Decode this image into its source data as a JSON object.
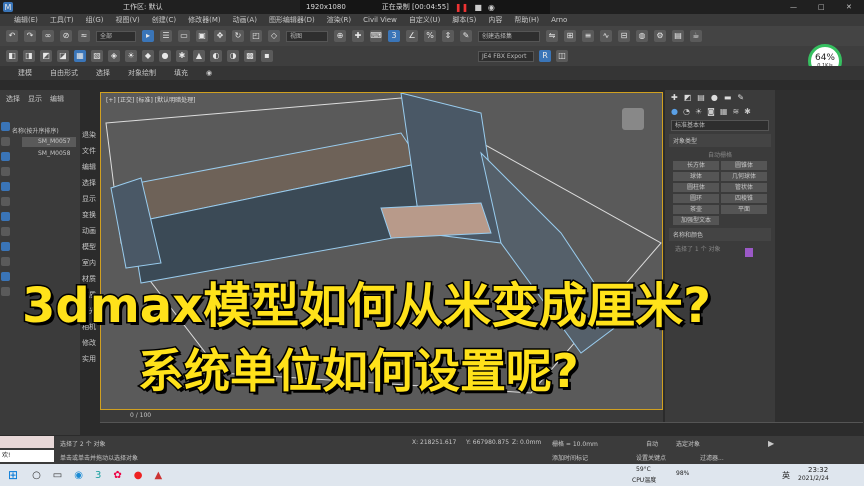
{
  "titlebar": {
    "workspace": "工作区: 默认",
    "resolution": "1920x1080",
    "recording": "正在录制 [00:04:55]"
  },
  "menubar": {
    "items": [
      "编辑(E)",
      "工具(T)",
      "组(G)",
      "视图(V)",
      "创建(C)",
      "修改器(M)",
      "动画(A)",
      "图形编辑器(D)",
      "渲染(R)",
      "Civil View",
      "自定义(U)",
      "脚本(S)",
      "内容",
      "帮助(H)",
      "Arno"
    ]
  },
  "toolbar": {
    "filter": "全部",
    "view": "视图",
    "named_set": "创建选择集"
  },
  "toolbar2": {
    "exporter": "JE4 FBX Export"
  },
  "ribbon": {
    "tabs": [
      "建模",
      "自由形式",
      "选择",
      "对象绘制",
      "填充"
    ]
  },
  "gauge": {
    "percent": "64%",
    "speed": "0.1K/s"
  },
  "scene_explorer": {
    "tabs": [
      "选择",
      "显示",
      "编辑"
    ],
    "sort_label": "名称(按升序排序)",
    "rows": [
      "SM_M0057",
      "SM_M0058"
    ]
  },
  "command_list": [
    "退染",
    "文件",
    "编辑",
    "选择",
    "显示",
    "变换",
    "动画",
    "模型",
    "室内",
    "材质",
    "材质",
    "灯光",
    "相机",
    "修改",
    "实用"
  ],
  "viewport": {
    "label": "[+] [正交] [标准] [默认明暗处理]"
  },
  "create_panel": {
    "dropdown": "标准基本体",
    "rollout": "对象类型",
    "autogrid": "自动栅格",
    "buttons": [
      "长方体",
      "圆锥体",
      "球体",
      "几何球体",
      "圆柱体",
      "管状体",
      "圆环",
      "四棱锥",
      "茶壶",
      "平面",
      "加强型文本"
    ],
    "name_color": "名称和颜色",
    "selection_info": "选择了 1 个 对象"
  },
  "timeline": {
    "frame": "0 / 100"
  },
  "status": {
    "selected": "选择了 2 个 对象",
    "prompt": "单击或单击并拖动以选择对象",
    "grid": "栅格 = 10.0mm",
    "autokey": "自动",
    "setkey": "设置关键点",
    "filter": "过滤器...",
    "select_obj": "选定对象",
    "add_time_tag": "添加时间标记",
    "x": "X: 218251.617",
    "y": "Y: 667980.875",
    "z": "Z: 0.0mm",
    "cmd": "欢!"
  },
  "taskbar": {
    "temp": "59°C",
    "temp_label": "CPU温度",
    "battery": "98%",
    "lang": "英",
    "time": "23:32",
    "date": "2021/2/24"
  },
  "overlay": {
    "line1": "3dmax模型如何从米变成厘米?",
    "line2": "系统单位如何设置呢?"
  },
  "colors": {
    "accent": "#3a75b8",
    "viewport_border": "#d0a020",
    "overlay_text": "#ffe21a",
    "gauge": "#36c060"
  }
}
